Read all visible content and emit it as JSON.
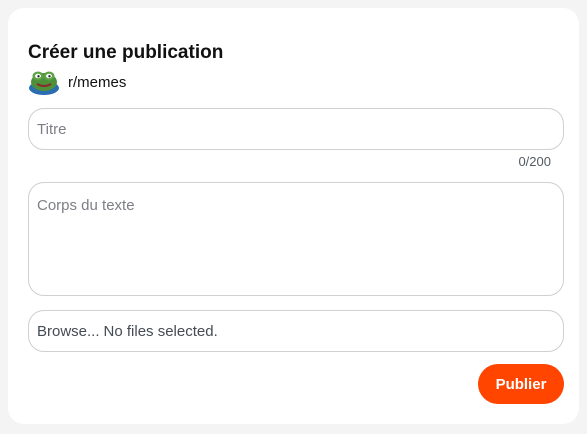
{
  "form": {
    "heading": "Créer une publication",
    "community": {
      "name": "r/memes",
      "avatar_icon": "frog-avatar-icon"
    },
    "title_input": {
      "placeholder": "Titre",
      "value": ""
    },
    "title_counter": "0/200",
    "body_input": {
      "placeholder": "Corps du texte",
      "value": ""
    },
    "file_input": {
      "button_label": "Browse...",
      "status": "No files selected."
    },
    "publish_label": "Publier"
  },
  "colors": {
    "accent": "#ff4500",
    "card_background": "#ffffff",
    "page_background": "#f4f4f5",
    "border": "#cfcfd4"
  }
}
